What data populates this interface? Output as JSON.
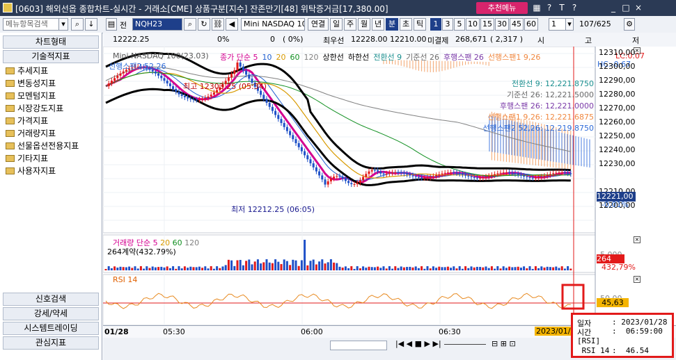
{
  "window": {
    "title": "[0603] 해외선옵 종합차트-실시간 - 거래소[CME] 상품구분[지수] 잔존만기[48] 위탁증거금[17,380.00]",
    "recommend_menu": "추천메뉴",
    "controls": [
      "?",
      "T",
      "?",
      "_",
      "□",
      "×"
    ]
  },
  "toolbar": {
    "menu_search_placeholder": "메뉴항목검색",
    "type_label": "전",
    "code": "NQH23",
    "product_name": "Mini NASDAQ 100(23.0",
    "period_buttons": [
      "연결",
      "일",
      "주",
      "월",
      "년",
      "분",
      "초",
      "틱"
    ],
    "selected_period": "분",
    "interval_buttons": [
      "1",
      "3",
      "5",
      "10",
      "15",
      "30",
      "45",
      "60"
    ],
    "selected_interval": "1",
    "interval_value": "1",
    "page_indicator": "107/625"
  },
  "infobar": {
    "price": "12222.25",
    "change_pct": "0%",
    "volume": "0",
    "volume_pct": "(    0%)",
    "best_bid_label": "최우선",
    "best_bid": "12228.00",
    "best_ask": "12210.00",
    "open_interest_label": "미결제",
    "open_interest": "268,671",
    "oi_change": "( 2,317 )",
    "ohlc_labels": [
      "시",
      "고",
      "저"
    ]
  },
  "leftpanel": {
    "chart_type_header": "차트형태",
    "tech_header": "기술적지표",
    "tree_items": [
      "추세지표",
      "변동성지표",
      "모멘텀지표",
      "시장강도지표",
      "가격지표",
      "거래량지표",
      "선물옵션전용지표",
      "기타지표",
      "사용자지표"
    ],
    "bottom_buttons": [
      "신호검색",
      "강세/약세",
      "시스템트레이딩",
      "관심지표"
    ]
  },
  "price_panel": {
    "legend_title": "Mini NASDAQ 100(23.03)",
    "legend_items": [
      {
        "text": "종가 단순 5",
        "color": "#d40090"
      },
      {
        "text": "10",
        "color": "#2060d0"
      },
      {
        "text": "20",
        "color": "#d89a00"
      },
      {
        "text": "60",
        "color": "#108f20"
      },
      {
        "text": "120",
        "color": "#808080"
      },
      {
        "text": "상한선",
        "color": "#000000"
      },
      {
        "text": "하한선",
        "color": "#000000"
      },
      {
        "text": "전환선 9",
        "color": "#1a8f8f"
      },
      {
        "text": "기준선 26",
        "color": "#6a6a6a"
      },
      {
        "text": "후행스팬 26",
        "color": "#7a3aa8"
      },
      {
        "text": "선행스팬1 9,26",
        "color": "#f08840"
      }
    ],
    "legend_line2": "선행스팬2 52,26",
    "lc": "LC:0.07",
    "hc": "HC:-0.67",
    "high_annotation": "최고 12303.25 (05:34)",
    "low_annotation": "최저 12212.25 (06:05)",
    "ichimoku_values": [
      {
        "text": "전환선 9: 12,221.8750",
        "color": "#1a8f8f"
      },
      {
        "text": "기준선 26: 12,221.5000",
        "color": "#6a6a6a"
      },
      {
        "text": "후행스팬 26: 12,221.0000",
        "color": "#7a3aa8"
      },
      {
        "text": "선행스팬1 9,26: 12,221.6875",
        "color": "#f08840"
      },
      {
        "text": "선행스팬2 52,26: 12,219.8750",
        "color": "#2c6ad8"
      }
    ],
    "y_ticks": [
      "12310,00",
      "12300,00",
      "12290,00",
      "12280,00",
      "12270,00",
      "12260,00",
      "12250,00",
      "12240,00",
      "12230,00",
      "12210,00",
      "12200,00"
    ],
    "current_price": "12221,00",
    "current_change": "-0,01%"
  },
  "volume_panel": {
    "legend": "거래량 단순 5",
    "legend_ma": [
      "20",
      "60",
      "120"
    ],
    "info": "264계약(432.79%)",
    "y_tick": "5,000",
    "current": "264",
    "current_pct": "432,79%"
  },
  "rsi_panel": {
    "legend": "RSI 14",
    "y_tick": "50,00",
    "current": "45,63"
  },
  "time_axis": {
    "labels": [
      "01/28",
      "05:30",
      "06:00",
      "06:30"
    ],
    "cursor_date": "2023/01/2"
  },
  "popup": {
    "date_label": "일자",
    "date_value": ": 2023/01/28",
    "time_label": "시간",
    "time_value": ":  06:59:00",
    "section": "[RSI]",
    "rsi_label": " RSI 14",
    "rsi_value": ":  46.54"
  }
}
